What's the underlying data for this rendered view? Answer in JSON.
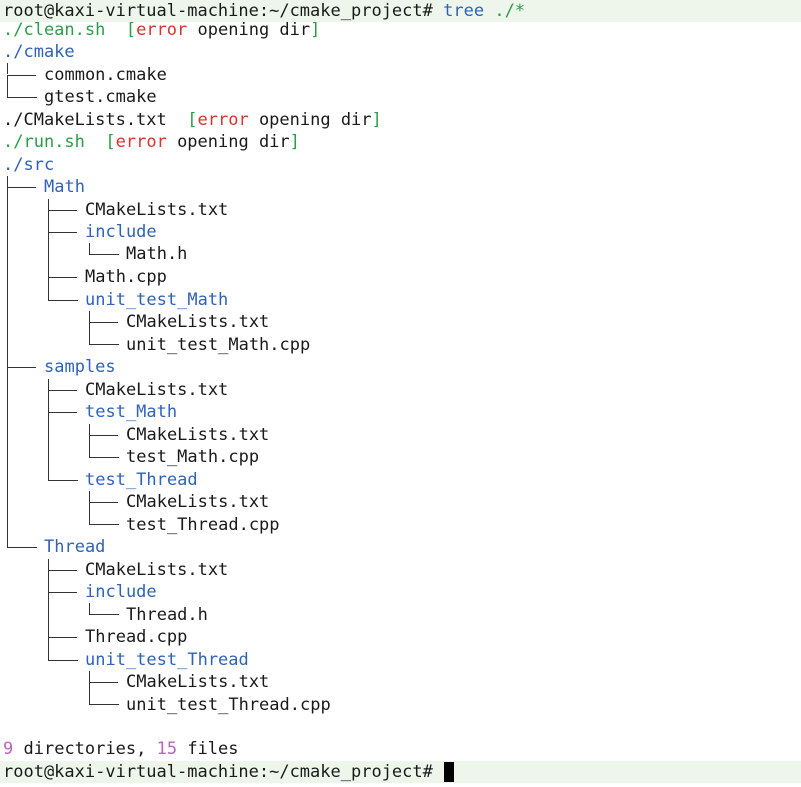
{
  "terminal": {
    "prompt": "root@kaxi-virtual-machine:~/cmake_project#",
    "command": "tree",
    "command_arg": "./*",
    "error_open": "[",
    "error_word": "error",
    "error_rest": "opening dir",
    "error_close": "]",
    "entries": [
      {
        "text": "./clean.sh",
        "kind": "exec",
        "error": true
      },
      {
        "text": "./cmake",
        "kind": "dir"
      },
      {
        "text": "common.cmake",
        "kind": "file"
      },
      {
        "text": "gtest.cmake",
        "kind": "file"
      },
      {
        "text": "./CMakeLists.txt",
        "kind": "file",
        "error": true
      },
      {
        "text": "./run.sh",
        "kind": "exec",
        "error": true
      },
      {
        "text": "./src",
        "kind": "dir"
      },
      {
        "text": "Math",
        "kind": "dir"
      },
      {
        "text": "CMakeLists.txt",
        "kind": "file"
      },
      {
        "text": "include",
        "kind": "dir"
      },
      {
        "text": "Math.h",
        "kind": "file"
      },
      {
        "text": "Math.cpp",
        "kind": "file"
      },
      {
        "text": "unit_test_Math",
        "kind": "dir"
      },
      {
        "text": "CMakeLists.txt",
        "kind": "file"
      },
      {
        "text": "unit_test_Math.cpp",
        "kind": "file"
      },
      {
        "text": "samples",
        "kind": "dir"
      },
      {
        "text": "CMakeLists.txt",
        "kind": "file"
      },
      {
        "text": "test_Math",
        "kind": "dir"
      },
      {
        "text": "CMakeLists.txt",
        "kind": "file"
      },
      {
        "text": "test_Math.cpp",
        "kind": "file"
      },
      {
        "text": "test_Thread",
        "kind": "dir"
      },
      {
        "text": "CMakeLists.txt",
        "kind": "file"
      },
      {
        "text": "test_Thread.cpp",
        "kind": "file"
      },
      {
        "text": "Thread",
        "kind": "dir"
      },
      {
        "text": "CMakeLists.txt",
        "kind": "file"
      },
      {
        "text": "include",
        "kind": "dir"
      },
      {
        "text": "Thread.h",
        "kind": "file"
      },
      {
        "text": "Thread.cpp",
        "kind": "file"
      },
      {
        "text": "unit_test_Thread",
        "kind": "dir"
      },
      {
        "text": "CMakeLists.txt",
        "kind": "file"
      },
      {
        "text": "unit_test_Thread.cpp",
        "kind": "file"
      }
    ],
    "summary": {
      "dir_count": "9",
      "dir_label": "directories,",
      "file_count": "15",
      "file_label": "files"
    }
  },
  "colors": {
    "directory": "#2f63b8",
    "executable": "#2a9d4a",
    "error": "#d6342f",
    "count": "#c060c0",
    "prompt_background": "#eef6ec"
  }
}
